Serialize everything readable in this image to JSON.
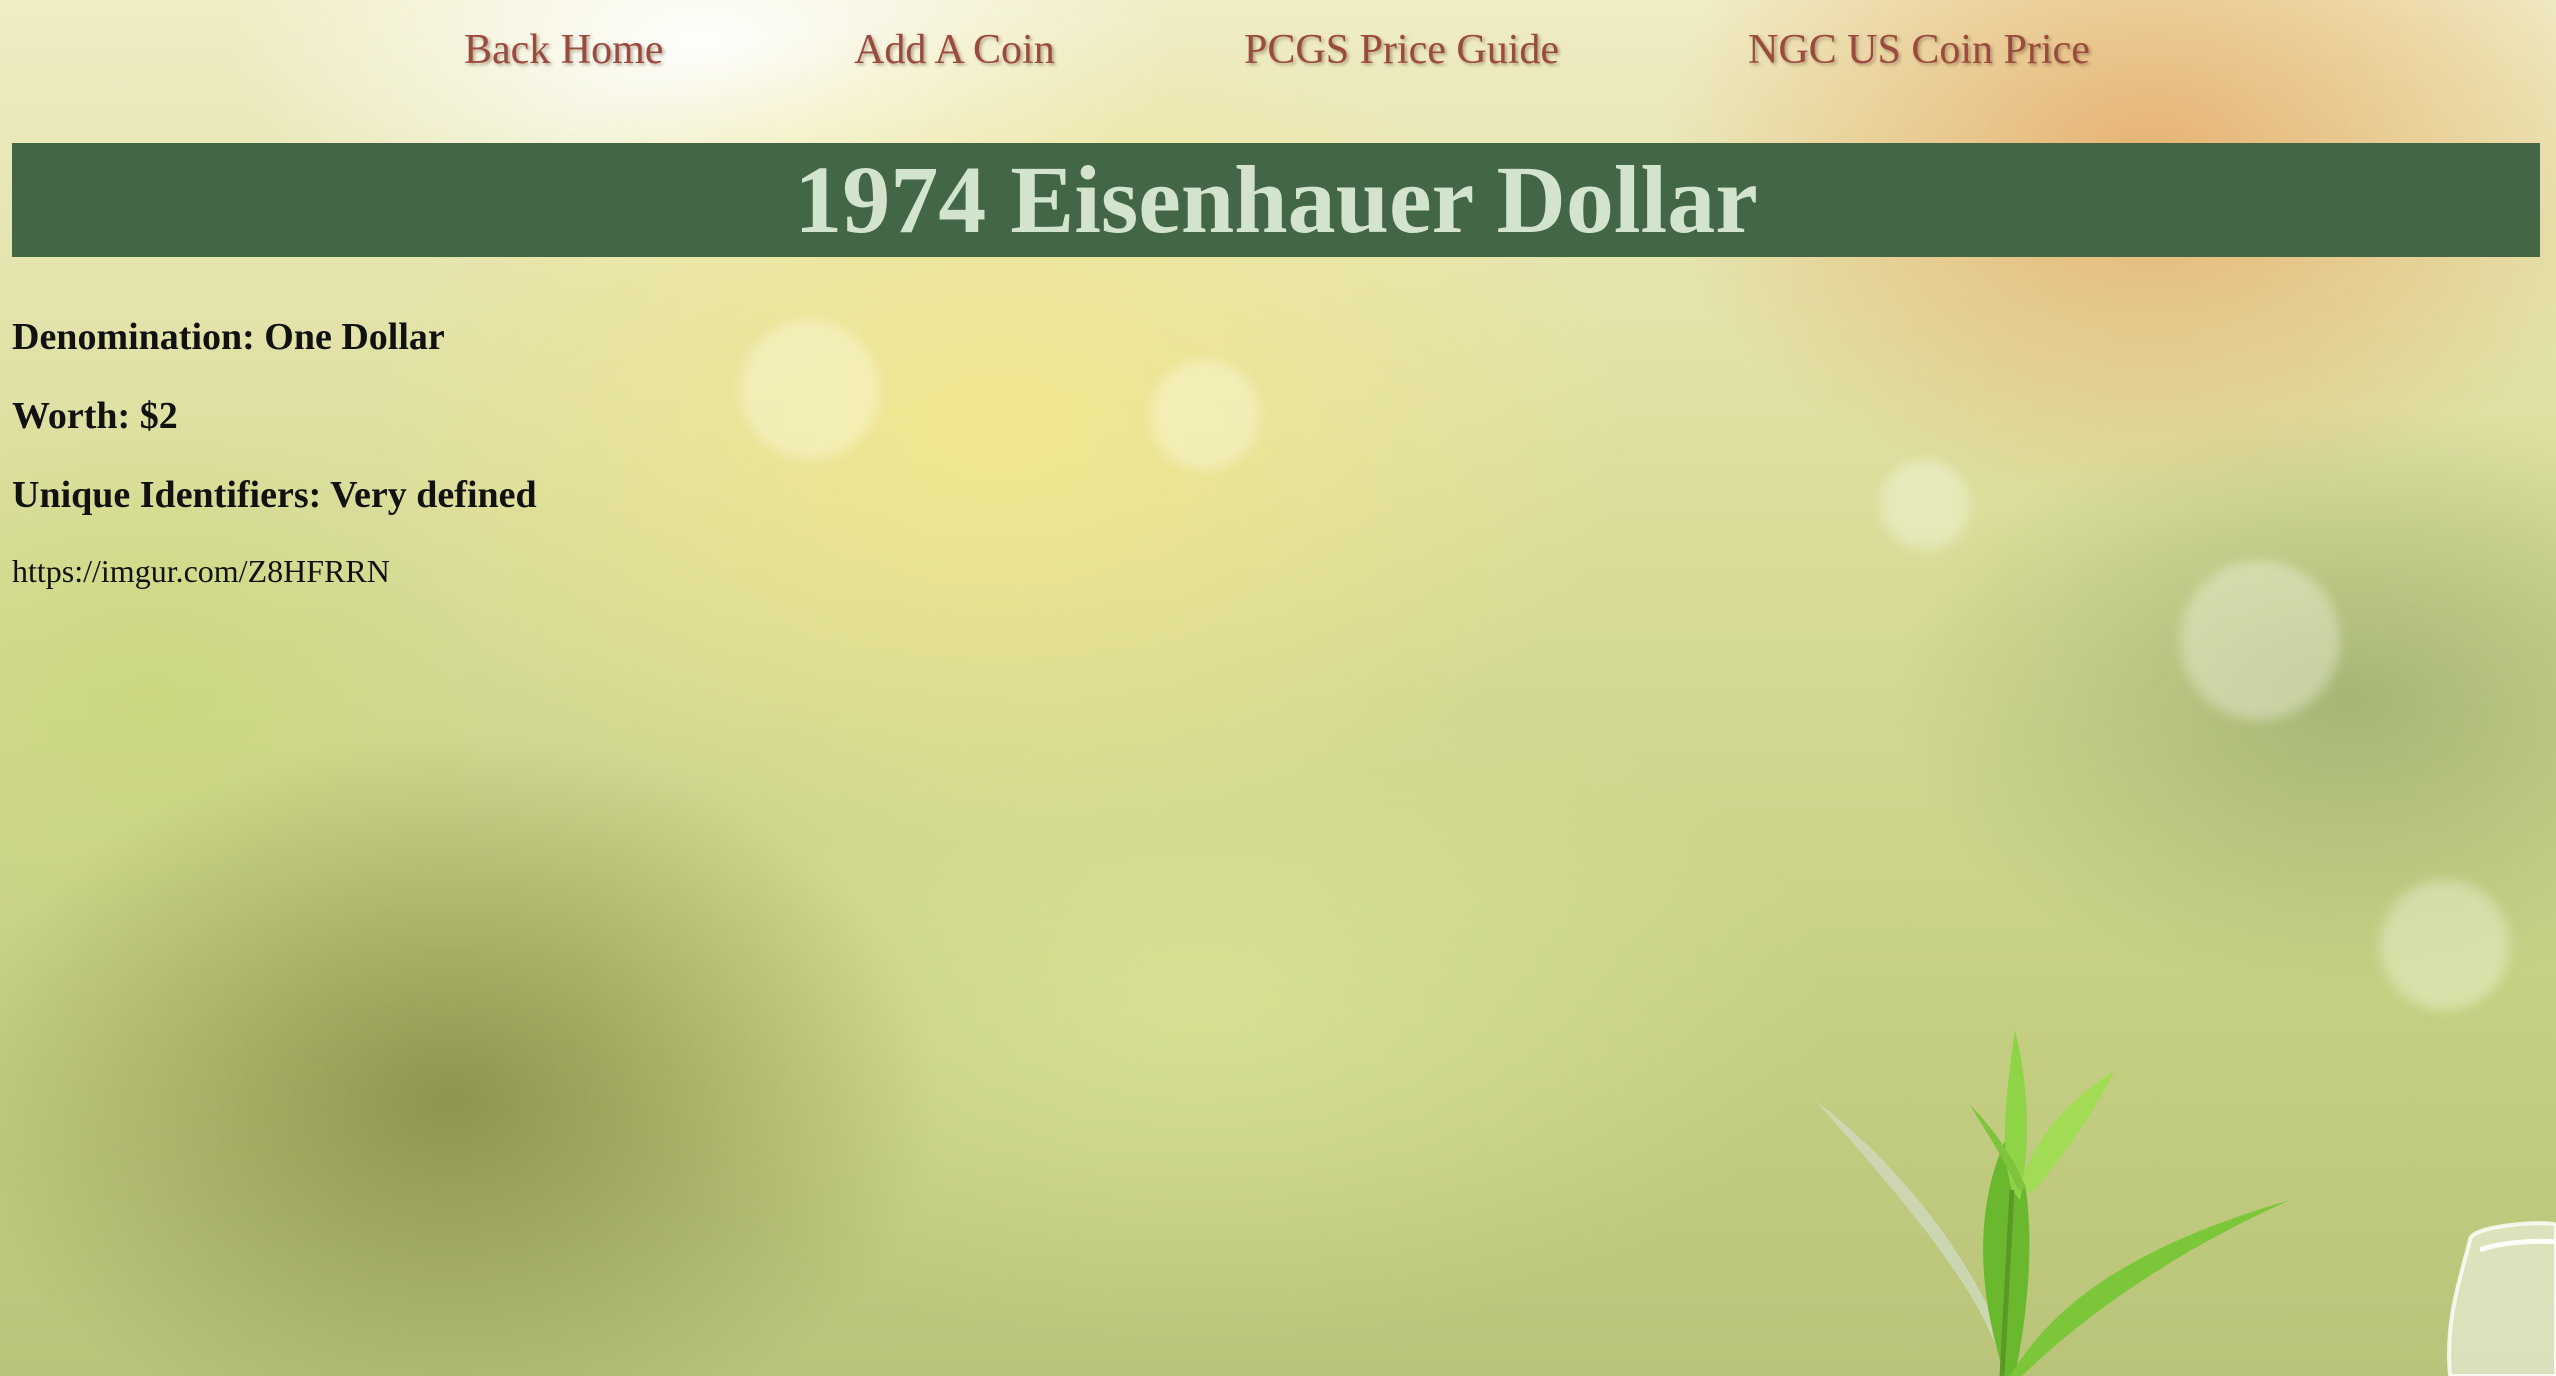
{
  "nav": {
    "items": [
      {
        "label": "Back Home"
      },
      {
        "label": "Add A Coin"
      },
      {
        "label": "PCGS Price Guide"
      },
      {
        "label": "NGC US Coin Price"
      }
    ]
  },
  "coin": {
    "title": "1974 Eisenhauer Dollar",
    "denomination": "Denomination: One Dollar",
    "worth": "Worth: $2",
    "identifiers": "Unique Identifiers: Very defined",
    "image_url": "https://imgur.com/Z8HFRRN"
  },
  "colors": {
    "banner_bg": "#436646",
    "banner_text": "#d3e4cc",
    "nav_link": "#9a4a3e"
  }
}
